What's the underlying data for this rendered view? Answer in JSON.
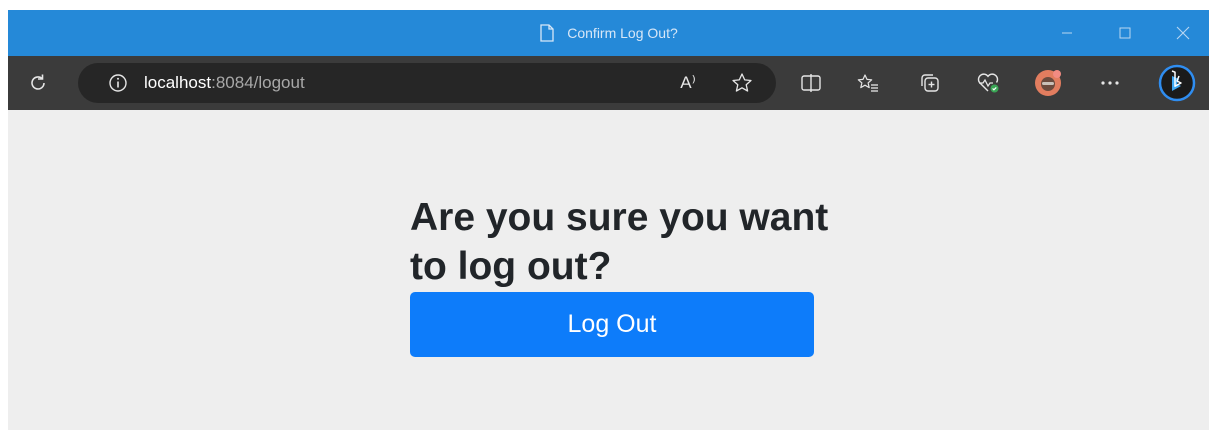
{
  "window": {
    "title": "Confirm Log Out?"
  },
  "toolbar": {
    "url_host": "localhost",
    "url_path": ":8084/logout",
    "read_aloud_label": "A⁾"
  },
  "page": {
    "heading": "Are you sure you want to log out?",
    "button_label": "Log Out"
  },
  "colors": {
    "titlebar": "#2589d8",
    "toolbar": "#3b3b3b",
    "page_background": "#eeeeee",
    "button": "#0d7cfa",
    "heading_text": "#212529"
  }
}
